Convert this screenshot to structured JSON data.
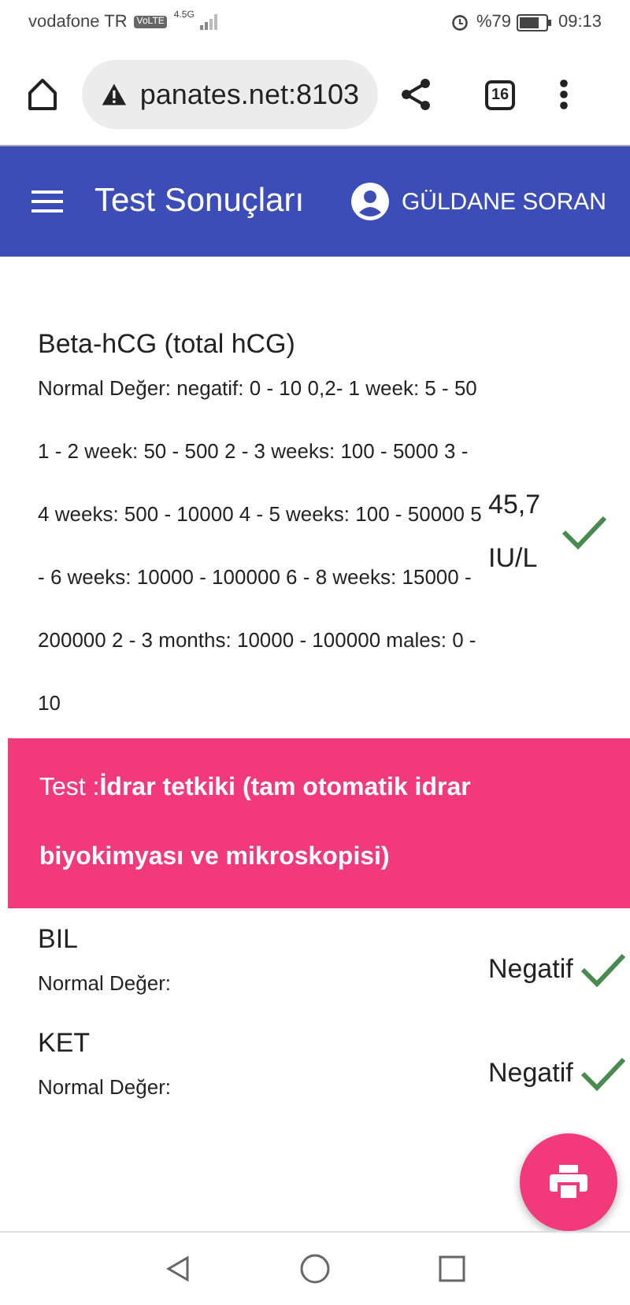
{
  "status_bar": {
    "carrier": "vodafone TR",
    "volte": "VoLTE",
    "network": "4.5G",
    "battery": "%79",
    "time": "09:13"
  },
  "browser": {
    "url": "panates.net:8103",
    "tab_count": "16"
  },
  "app_bar": {
    "title": "Test Sonuçları",
    "user": "GÜLDANE SORAN"
  },
  "items": [
    {
      "kind": "result",
      "name": "Beta-hCG (total hCG)",
      "normal_range": "Normal Değer: negatif: 0 - 10 0,2- 1 week: 5 - 50 1 - 2 week: 50 - 500 2 - 3 weeks: 100 - 5000 3 - 4 weeks: 500 - 10000 4 - 5 weeks: 100 - 50000 5 - 6 weeks: 10000 - 100000 6 - 8 weeks: 15000 - 200000 2 - 3 months: 10000 - 100000 males: 0 - 10",
      "value": "45,7 IU/L",
      "checked": true
    },
    {
      "kind": "section",
      "label": "Test :",
      "name": "İdrar tetkiki (tam otomatik idrar biyokimyası ve mikroskopisi)"
    },
    {
      "kind": "result",
      "name": "BIL",
      "normal_range": "Normal Değer:",
      "value": "Negatif",
      "checked": true
    },
    {
      "kind": "result",
      "name": "KET",
      "normal_range": "Normal Değer:",
      "value": "Negatif",
      "checked": true
    }
  ]
}
